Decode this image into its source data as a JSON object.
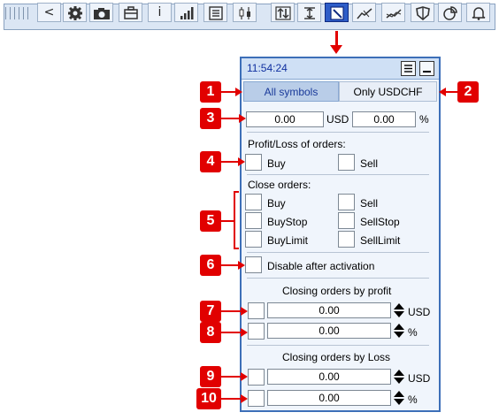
{
  "toolbar": {
    "icons": [
      "grip-icon",
      "back-icon",
      "gear-icon",
      "camera-icon",
      "briefcase-icon",
      "info-icon",
      "signal-bars-icon",
      "list-icon",
      "candlestick-icon",
      "sort-arrows-icon",
      "level-icon",
      "panel-pen-icon",
      "trend-line-icon",
      "trend-cross-icon",
      "shield-icon",
      "pie-chart-icon",
      "bell-icon"
    ],
    "back_glyph": "<",
    "info_glyph": "i"
  },
  "panel": {
    "time": "11:54:24",
    "tabs": [
      "All symbols",
      "Only USDCHF"
    ],
    "amount_usd": "0.00",
    "usd_unit": "USD",
    "amount_pct": "0.00",
    "pct_unit": "%",
    "pl_title": "Profit/Loss of orders:",
    "pl_buy": "Buy",
    "pl_sell": "Sell",
    "close_title": "Close orders:",
    "close_left": [
      "Buy",
      "BuyStop",
      "BuyLimit"
    ],
    "close_right": [
      "Sell",
      "SellStop",
      "SellLimit"
    ],
    "disable_label": "Disable after activation",
    "profit_title": "Closing orders by profit",
    "profit_rows": [
      {
        "value": "0.00",
        "unit": "USD"
      },
      {
        "value": "0.00",
        "unit": "%"
      }
    ],
    "loss_title": "Closing orders by Loss",
    "loss_rows": [
      {
        "value": "0.00",
        "unit": "USD"
      },
      {
        "value": "0.00",
        "unit": "%"
      }
    ]
  },
  "callouts": [
    "1",
    "2",
    "3",
    "4",
    "5",
    "6",
    "7",
    "8",
    "9",
    "10"
  ],
  "colors": {
    "accent": "#e10000",
    "panel_border": "#3d6fb8",
    "active_tab": "#b9cde8",
    "time_text": "#1030a0"
  }
}
